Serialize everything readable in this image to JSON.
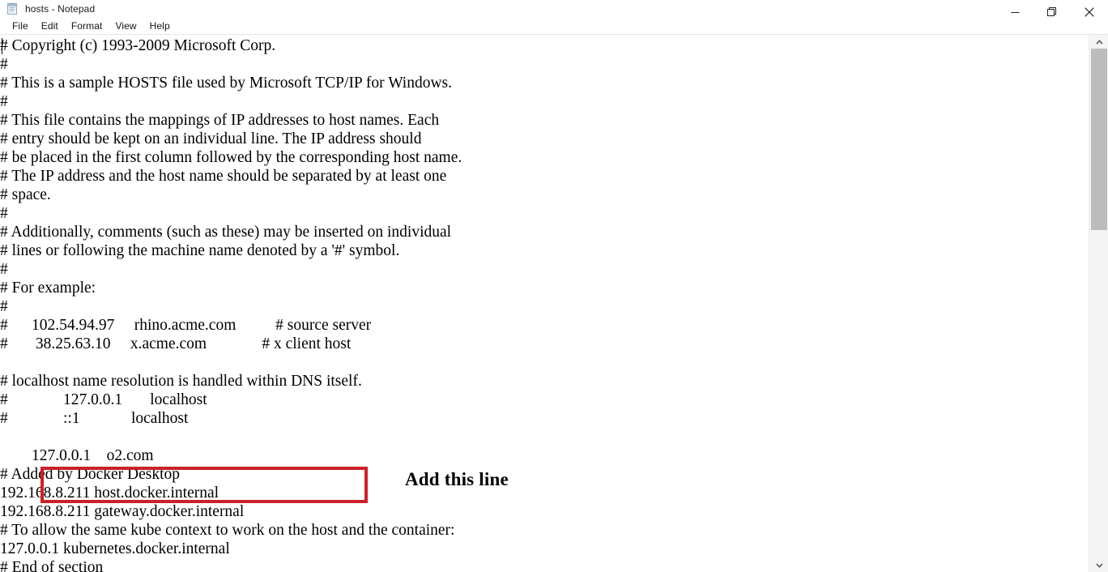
{
  "window": {
    "title": "hosts - Notepad",
    "app_icon": "notepad-icon",
    "controls": {
      "minimize": "Minimize",
      "restore": "Restore Down",
      "close": "Close"
    }
  },
  "menubar": {
    "items": [
      {
        "label": "File"
      },
      {
        "label": "Edit"
      },
      {
        "label": "Format"
      },
      {
        "label": "View"
      },
      {
        "label": "Help"
      }
    ]
  },
  "editor": {
    "content": "# Copyright (c) 1993-2009 Microsoft Corp.\n#\n# This is a sample HOSTS file used by Microsoft TCP/IP for Windows.\n#\n# This file contains the mappings of IP addresses to host names. Each\n# entry should be kept on an individual line. The IP address should\n# be placed in the first column followed by the corresponding host name.\n# The IP address and the host name should be separated by at least one\n# space.\n#\n# Additionally, comments (such as these) may be inserted on individual\n# lines or following the machine name denoted by a '#' symbol.\n#\n# For example:\n#\n#      102.54.94.97     rhino.acme.com          # source server\n#       38.25.63.10     x.acme.com              # x client host\n\n# localhost name resolution is handled within DNS itself.\n#\t\t127.0.0.1       localhost\n#\t\t::1             localhost\n\n        127.0.0.1    o2.com\n# Added by Docker Desktop\n192.168.8.211 host.docker.internal\n192.168.8.211 gateway.docker.internal\n# To allow the same kube context to work on the host and the container:\n127.0.0.1 kubernetes.docker.internal\n# End of section",
    "lines": [
      "# Copyright (c) 1993-2009 Microsoft Corp.",
      "#",
      "# This is a sample HOSTS file used by Microsoft TCP/IP for Windows.",
      "#",
      "# This file contains the mappings of IP addresses to host names. Each",
      "# entry should be kept on an individual line. The IP address should",
      "# be placed in the first column followed by the corresponding host name.",
      "# The IP address and the host name should be separated by at least one",
      "# space.",
      "#",
      "# Additionally, comments (such as these) may be inserted on individual",
      "# lines or following the machine name denoted by a '#' symbol.",
      "#",
      "# For example:",
      "#",
      "#      102.54.94.97     rhino.acme.com          # source server",
      "#       38.25.63.10     x.acme.com              # x client host",
      "",
      "# localhost name resolution is handled within DNS itself.",
      "#        127.0.0.1       localhost",
      "#        ::1             localhost",
      "",
      "        127.0.0.1    o2.com",
      "# Added by Docker Desktop",
      "192.168.8.211 host.docker.internal",
      "192.168.8.211 gateway.docker.internal",
      "# To allow the same kube context to work on the host and the container:",
      "127.0.0.1 kubernetes.docker.internal",
      "# End of section"
    ],
    "highlighted_line": "127.0.0.1    o2.com"
  },
  "annotation": {
    "label": "Add this line",
    "box_color": "#cc2029"
  },
  "scrollbar": {
    "up_arrow": "chevron-up-icon",
    "down_arrow": "chevron-down-icon"
  }
}
